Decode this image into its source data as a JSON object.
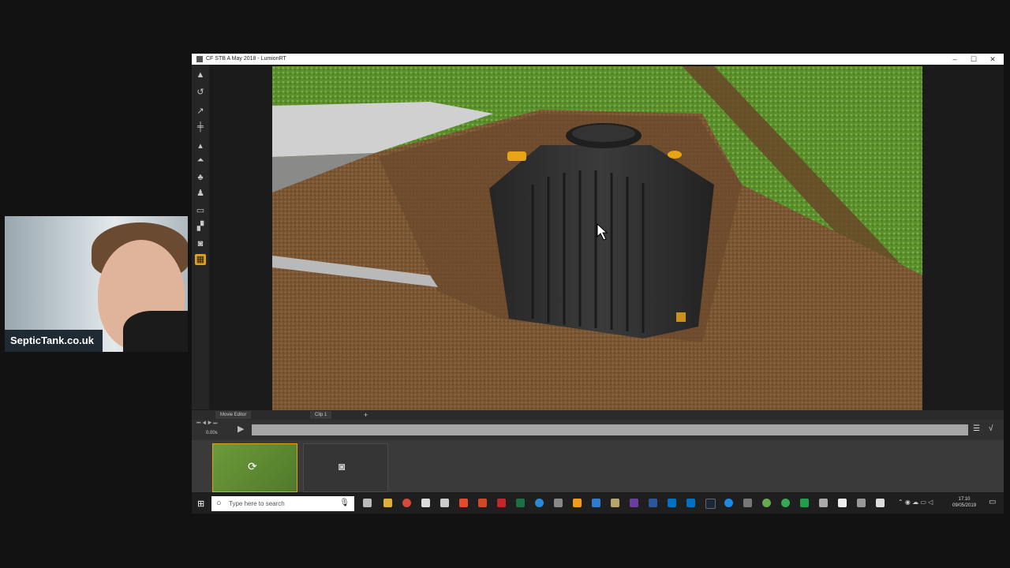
{
  "window": {
    "title": "CF STB A May 2018 - LumionRT",
    "minimize": "–",
    "maximize": "☐",
    "close": "✕"
  },
  "webcam": {
    "caption": "SepticTank.co.uk"
  },
  "movie_editor": {
    "tab_label": "Movie Editor",
    "clip_tab": "Clip 1",
    "add_symbol": "+",
    "time": "0.00s"
  },
  "taskbar": {
    "search_placeholder": "Type here to search",
    "time": "17:10",
    "date": "09/05/2019"
  },
  "colors": {
    "accent": "#e2a11a",
    "grass": "#5a8c2e",
    "soil": "#7a5533",
    "tank": "#2e2e2e"
  }
}
